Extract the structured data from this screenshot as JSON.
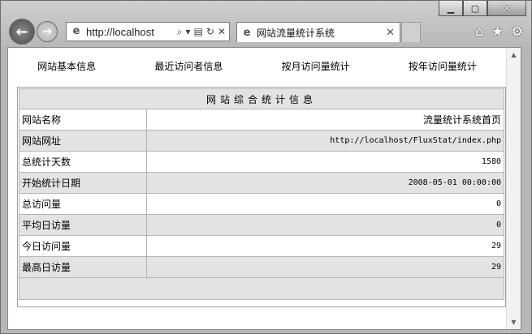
{
  "browser": {
    "address": {
      "url": "http://localhost"
    },
    "tab": {
      "title": "网站流量统计系统"
    }
  },
  "menu": {
    "items": [
      "网站基本信息",
      "最近访问者信息",
      "按月访问量统计",
      "按年访问量统计"
    ]
  },
  "table": {
    "title": "网站综合统计信息",
    "rows": [
      {
        "label": "网站名称",
        "value": "流量统计系统首页"
      },
      {
        "label": "网站网址",
        "value": "http://localhost/FluxStat/index.php"
      },
      {
        "label": "总统计天数",
        "value": "1580"
      },
      {
        "label": "开始统计日期",
        "value": "2008-05-01 00:00:00"
      },
      {
        "label": "总访问量",
        "value": "0"
      },
      {
        "label": "平均日访量",
        "value": "0"
      },
      {
        "label": "今日访问量",
        "value": "29"
      },
      {
        "label": "最高日访量",
        "value": "29"
      }
    ]
  }
}
